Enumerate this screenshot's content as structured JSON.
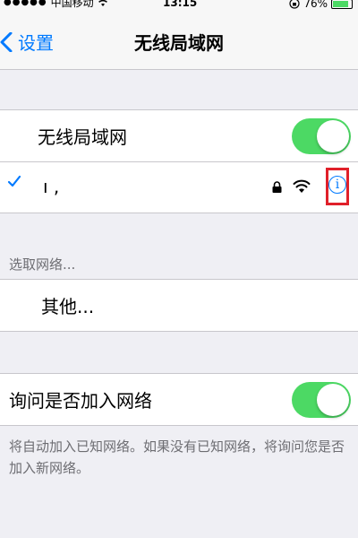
{
  "status_bar": {
    "carrier": "中国移动",
    "time": "13:15",
    "battery": "76%",
    "battery_level": 0.76
  },
  "nav": {
    "back_label": "设置",
    "title": "无线局域网"
  },
  "wifi_group": {
    "toggle_label": "无线局域网",
    "toggle_on": true,
    "connected_network": "ı  ,",
    "network_secured": true
  },
  "choose_section": {
    "header": "选取网络...",
    "other_label": "其他..."
  },
  "ask_group": {
    "label": "询问是否加入网络",
    "toggle_on": true,
    "footer": "将自动加入已知网络。如果没有已知网络，将询问您是否加入新网络。"
  },
  "icons": {
    "back": "chevron-left-icon",
    "check": "checkmark-icon",
    "lock": "lock-icon",
    "wifi": "wifi-icon",
    "info": "info-icon"
  },
  "colors": {
    "accent": "#007aff",
    "toggle_on": "#4cd964",
    "highlight": "#e0202a",
    "background": "#efeff4"
  }
}
